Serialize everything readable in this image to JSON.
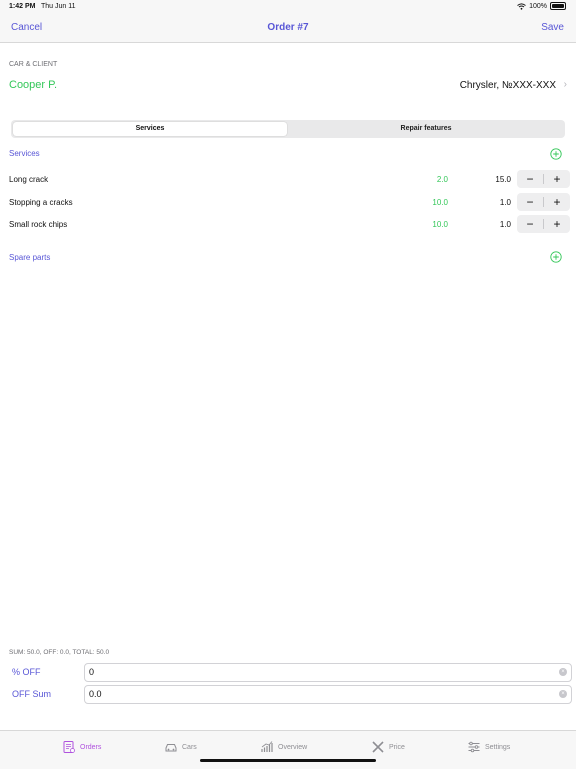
{
  "status_bar": {
    "time": "1:42 PM",
    "date": "Thu Jun 11",
    "battery": "100%"
  },
  "nav": {
    "cancel_label": "Cancel",
    "title": "Order #7",
    "save_label": "Save"
  },
  "car_client": {
    "header": "CAR & CLIENT",
    "client_name": "Cooper P.",
    "car": "Chrysler, №XXX-XXX"
  },
  "segments": {
    "services": "Services",
    "repair_features": "Repair features"
  },
  "services": {
    "label": "Services",
    "items": [
      {
        "name": "Long crack",
        "price": "2.0",
        "qty": "15.0"
      },
      {
        "name": "Stopping a cracks",
        "price": "10.0",
        "qty": "1.0"
      },
      {
        "name": "Small rock chips",
        "price": "10.0",
        "qty": "1.0"
      }
    ]
  },
  "spare_parts": {
    "label": "Spare parts"
  },
  "totals": {
    "summary": "SUM: 50.0, OFF: 0.0, TOTAL: 50.0"
  },
  "discount": {
    "percent_label": "% OFF",
    "percent_value": "0",
    "sum_label": "OFF Sum",
    "sum_value": "0.0"
  },
  "tabs": {
    "orders": "Orders",
    "cars": "Cars",
    "overview": "Overview",
    "price": "Price",
    "settings": "Settings"
  },
  "colors": {
    "accent": "#5856d6",
    "green": "#34c759",
    "active_tab": "#af52de"
  }
}
